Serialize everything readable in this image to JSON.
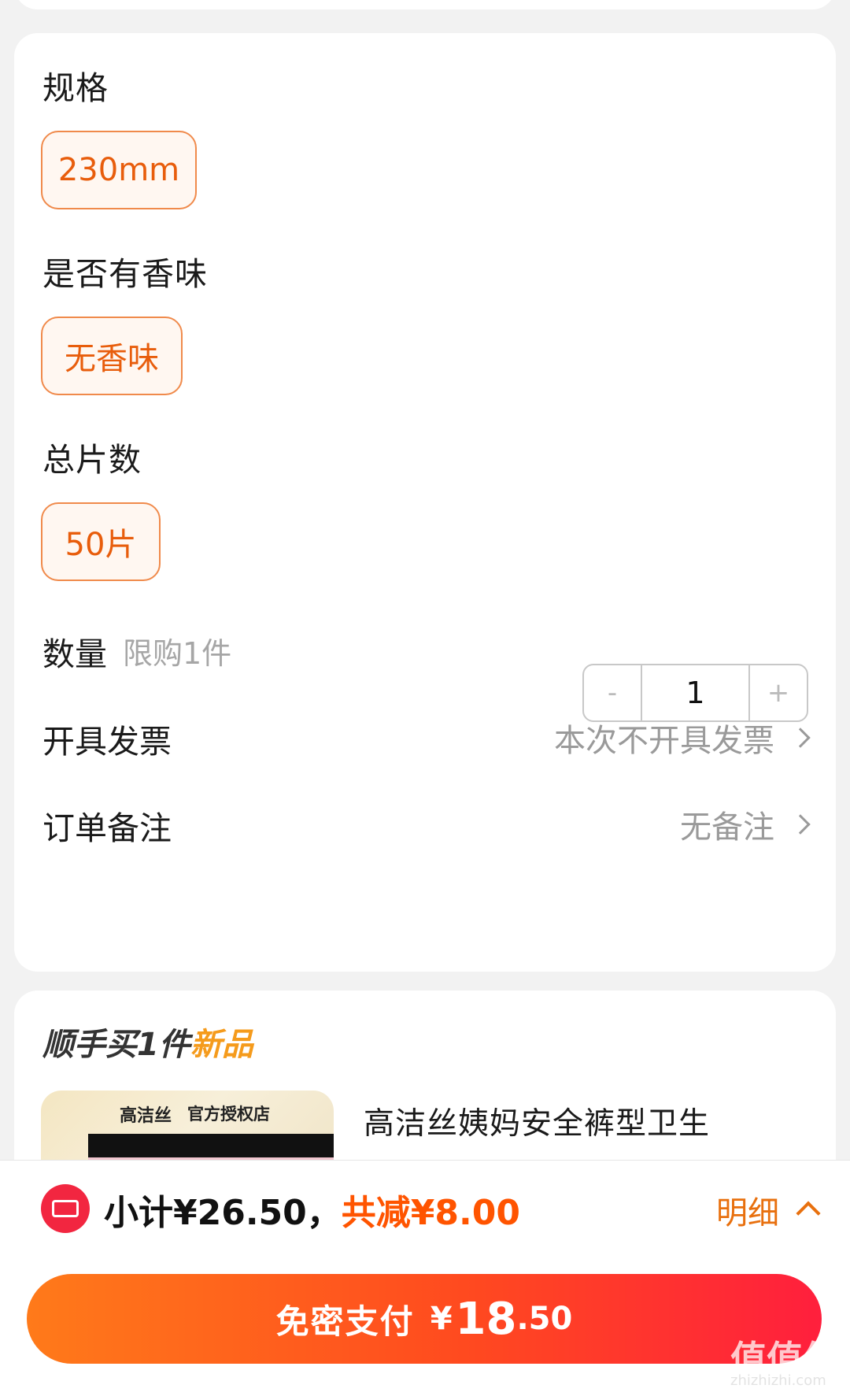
{
  "specs": {
    "size_title": "规格",
    "size_option": "230mm",
    "scent_title": "是否有香味",
    "scent_option": "无香味",
    "count_title": "总片数",
    "count_option": "50片"
  },
  "quantity": {
    "label": "数量",
    "limit": "限购1件",
    "minus": "-",
    "value": "1",
    "plus": "+"
  },
  "invoice": {
    "label": "开具发票",
    "value": "本次不开具发票"
  },
  "remark": {
    "label": "订单备注",
    "value": "无备注"
  },
  "addon": {
    "title": "顺手买1件",
    "tag": "新品",
    "thumb_brand": "高洁丝",
    "thumb_shop": "官方授权店",
    "product_name": "高洁丝姨妈安全裤型卫生"
  },
  "bottom": {
    "subtotal": "小计¥26.50，",
    "discount": "共减¥8.00",
    "detail": "明细",
    "pay_label": "免密支付",
    "currency": "¥",
    "price_int": "18",
    "price_dec": ".50"
  },
  "watermark": {
    "text": "值值值",
    "site": "zhizhizhi.com"
  },
  "colors": {
    "accent": "#e85d0c",
    "pay_start": "#ff7a1a",
    "pay_end": "#ff1f3d",
    "coupon": "#f22640"
  }
}
